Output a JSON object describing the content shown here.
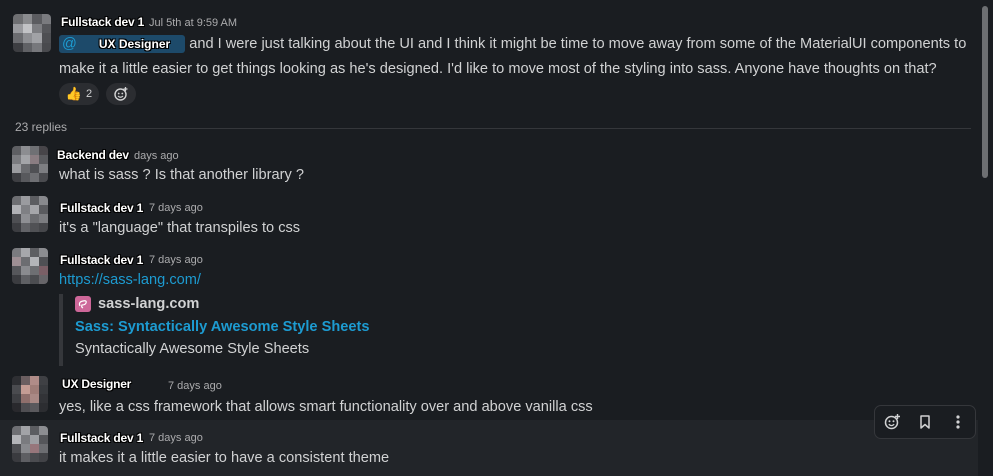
{
  "parent": {
    "author": "Fullstack dev 1",
    "timestamp": "Jul 5th at 9:59 AM",
    "mention_prefix": "@",
    "mention_name": "UX Designer",
    "line1": " and I were just talking about the UI and I think it might be time to move away from some of the MaterialUI components to",
    "line2": "make it a little easier to get things looking as he's designed. I'd like to move most of the styling into sass. Anyone have thoughts on that?",
    "reaction_emoji": "👍",
    "reaction_count": "2"
  },
  "replies_label": "23 replies",
  "replies": [
    {
      "author": "Backend dev",
      "timestamp": "days ago",
      "text": "what is sass ? Is that another library ?"
    },
    {
      "author": "Fullstack dev 1",
      "timestamp": "7 days ago",
      "text": "it's a \"language\" that transpiles to css"
    },
    {
      "author": "Fullstack dev 1",
      "timestamp": "7 days ago",
      "text": "https://sass-lang.com/"
    },
    {
      "author": "UX Designer",
      "timestamp": "7 days ago",
      "text": "yes, like a css framework that allows smart functionality over and above vanilla css"
    },
    {
      "author": "Fullstack dev 1",
      "timestamp": "7 days ago",
      "text": "it makes it a little easier to have a consistent theme"
    }
  ],
  "unfurl": {
    "site": "sass-lang.com",
    "title": "Sass: Syntactically Awesome Style Sheets",
    "description": "Syntactically Awesome Style Sheets"
  },
  "toolbar": {
    "icons": [
      "add-reaction-icon",
      "bookmark-icon",
      "more-actions-icon"
    ]
  },
  "colors": {
    "background": "#1a1d21",
    "link": "#1d9bd1",
    "sass_brand": "#cd6799"
  }
}
